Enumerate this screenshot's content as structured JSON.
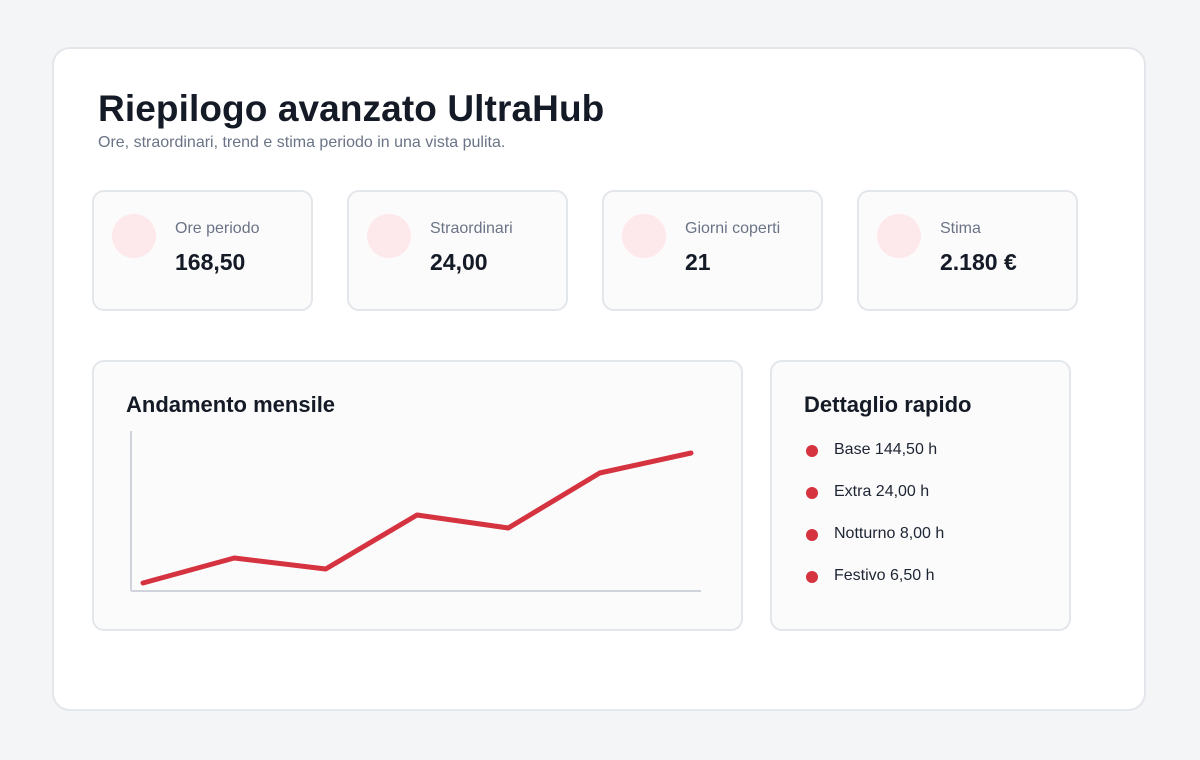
{
  "header": {
    "title": "Riepilogo avanzato UltraHub",
    "subtitle": "Ore, straordinari, trend e stima periodo in una vista pulita."
  },
  "kpis": [
    {
      "label": "Ore periodo",
      "value": "168,50"
    },
    {
      "label": "Straordinari",
      "value": "24,00"
    },
    {
      "label": "Giorni coperti",
      "value": "21"
    },
    {
      "label": "Stima",
      "value": "2.180 €"
    }
  ],
  "trend": {
    "title": "Andamento mensile"
  },
  "chart_data": {
    "type": "line",
    "title": "Andamento mensile",
    "x": [
      1,
      2,
      3,
      4,
      5,
      6,
      7
    ],
    "series": [
      {
        "values": [
          8,
          33,
          22,
          76,
          63,
          118,
          138
        ]
      }
    ],
    "ylim": [
      0,
      160
    ],
    "grid": false,
    "color": "#d63340"
  },
  "detail": {
    "title": "Dettaglio rapido",
    "items": [
      {
        "text": "Base 144,50 h"
      },
      {
        "text": "Extra 24,00 h"
      },
      {
        "text": "Notturno 8,00 h"
      },
      {
        "text": "Festivo 6,50 h"
      }
    ]
  },
  "colors": {
    "accent": "#d63340",
    "accent_soft": "#fde8eb",
    "text": "#141a26",
    "muted": "#6b7486"
  }
}
